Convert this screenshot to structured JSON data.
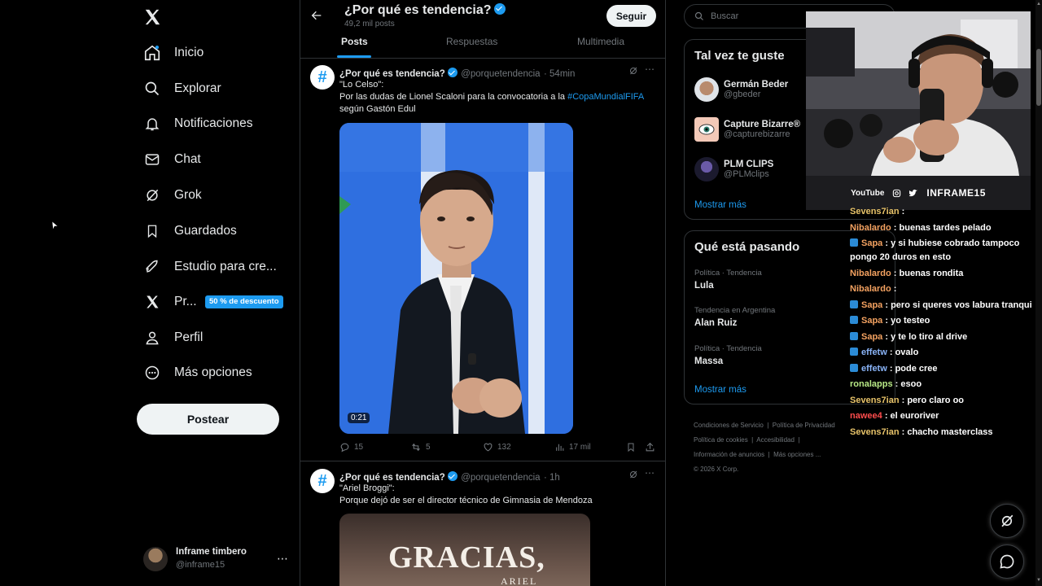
{
  "nav": {
    "items": [
      {
        "label": "Inicio",
        "icon": "home-icon"
      },
      {
        "label": "Explorar",
        "icon": "search-icon"
      },
      {
        "label": "Notificaciones",
        "icon": "bell-icon"
      },
      {
        "label": "Chat",
        "icon": "mail-icon"
      },
      {
        "label": "Grok",
        "icon": "grok-icon"
      },
      {
        "label": "Guardados",
        "icon": "bookmark-icon"
      },
      {
        "label": "Estudio para cre...",
        "icon": "rocket-icon"
      },
      {
        "label": "Pr...",
        "icon": "x-logo-icon"
      },
      {
        "label": "Perfil",
        "icon": "person-icon"
      },
      {
        "label": "Más opciones",
        "icon": "more-circle-icon"
      }
    ],
    "premium_badge": "50 % de descuento",
    "post_button": "Postear"
  },
  "account": {
    "name": "Inframe timbero",
    "handle": "@inframe15"
  },
  "header": {
    "title": "¿Por qué es tendencia?",
    "subtitle": "49,2 mil posts",
    "follow_button": "Seguir"
  },
  "tabs": [
    "Posts",
    "Respuestas",
    "Multimedia"
  ],
  "tweets": [
    {
      "name": "¿Por qué es tendencia?",
      "handle": "@porquetendencia",
      "time": "· 54min",
      "line1": "\"Lo Celso\":",
      "line2": "Por las dudas de Lionel Scaloni para la convocatoria a la",
      "hashtag": "#CopaMundialFIFA",
      "line3": "según Gastón Edul",
      "video_duration": "0:21",
      "replies": "15",
      "reposts": "5",
      "likes": "132",
      "views": "17 mil"
    },
    {
      "name": "¿Por qué es tendencia?",
      "handle": "@porquetendencia",
      "time": "· 1h",
      "line1": "\"Ariel Broggi\":",
      "line2": "Porque dejó de ser el director técnico de Gimnasia de Mendoza",
      "image_title": "GRACIAS,",
      "image_sub": "ARIEL"
    }
  ],
  "search": {
    "placeholder": "Buscar"
  },
  "suggestions": {
    "title": "Tal vez te guste",
    "items": [
      {
        "name": "Germán Beder",
        "handle": "@gbeder"
      },
      {
        "name": "Capture Bizarre®",
        "handle": "@capturebizarre"
      },
      {
        "name": "PLM CLIPS",
        "handle": "@PLMclips"
      }
    ],
    "more": "Mostrar más"
  },
  "trends": {
    "title": "Qué está pasando",
    "items": [
      {
        "category": "Política · Tendencia",
        "name": "Lula"
      },
      {
        "category": "Tendencia en Argentina",
        "name": "Alan Ruiz"
      },
      {
        "category": "Política · Tendencia",
        "name": "Massa"
      }
    ],
    "more": "Mostrar más"
  },
  "footer": {
    "links": [
      "Condiciones de Servicio",
      "Política de Privacidad",
      "Política de cookies",
      "Accesibilidad",
      "Información de anuncios",
      "Más opciones ..."
    ],
    "copyright": "© 2026 X Corp."
  },
  "stream": {
    "bar_youtube": "YouTube",
    "bar_name": "INFRAME15"
  },
  "chat": [
    {
      "user": "Sevens7ian",
      "color": "#e9c46a",
      "badge": false,
      "msg": ":"
    },
    {
      "user": "Nibalardo",
      "color": "#f4a261",
      "badge": false,
      "msg": ": buenas tardes pelado"
    },
    {
      "user": "Sapa",
      "color": "#f4a261",
      "badge": true,
      "msg": ": y si hubiese cobrado tampoco pongo 20 duros en esto"
    },
    {
      "user": "Nibalardo",
      "color": "#f4a261",
      "badge": false,
      "msg": ": buenas rondita"
    },
    {
      "user": "Nibalardo",
      "color": "#f4a261",
      "badge": false,
      "msg": ":"
    },
    {
      "user": "Sapa",
      "color": "#f4a261",
      "badge": true,
      "msg": ": pero si queres vos labura tranqui"
    },
    {
      "user": "Sapa",
      "color": "#f4a261",
      "badge": true,
      "msg": ": yo testeo"
    },
    {
      "user": "Sapa",
      "color": "#f4a261",
      "badge": true,
      "msg": ": y te lo tiro al drive"
    },
    {
      "user": "effetw",
      "color": "#8ab4f8",
      "badge": true,
      "msg": ": ovalo"
    },
    {
      "user": "effetw",
      "color": "#8ab4f8",
      "badge": true,
      "msg": ": pode cree"
    },
    {
      "user": "ronalapps",
      "color": "#b8e986",
      "badge": false,
      "msg": ": esoo"
    },
    {
      "user": "Sevens7ian",
      "color": "#e9c46a",
      "badge": false,
      "msg": ": pero claro oo"
    },
    {
      "user": "nawee4",
      "color": "#ff4d4d",
      "badge": false,
      "msg": ": el euroriver"
    },
    {
      "user": "Sevens7ian",
      "color": "#e9c46a",
      "badge": false,
      "msg": ": chacho masterclass"
    }
  ],
  "colors": {
    "accent": "#1d9bf0",
    "border": "#2f3336",
    "muted": "#71767b"
  }
}
